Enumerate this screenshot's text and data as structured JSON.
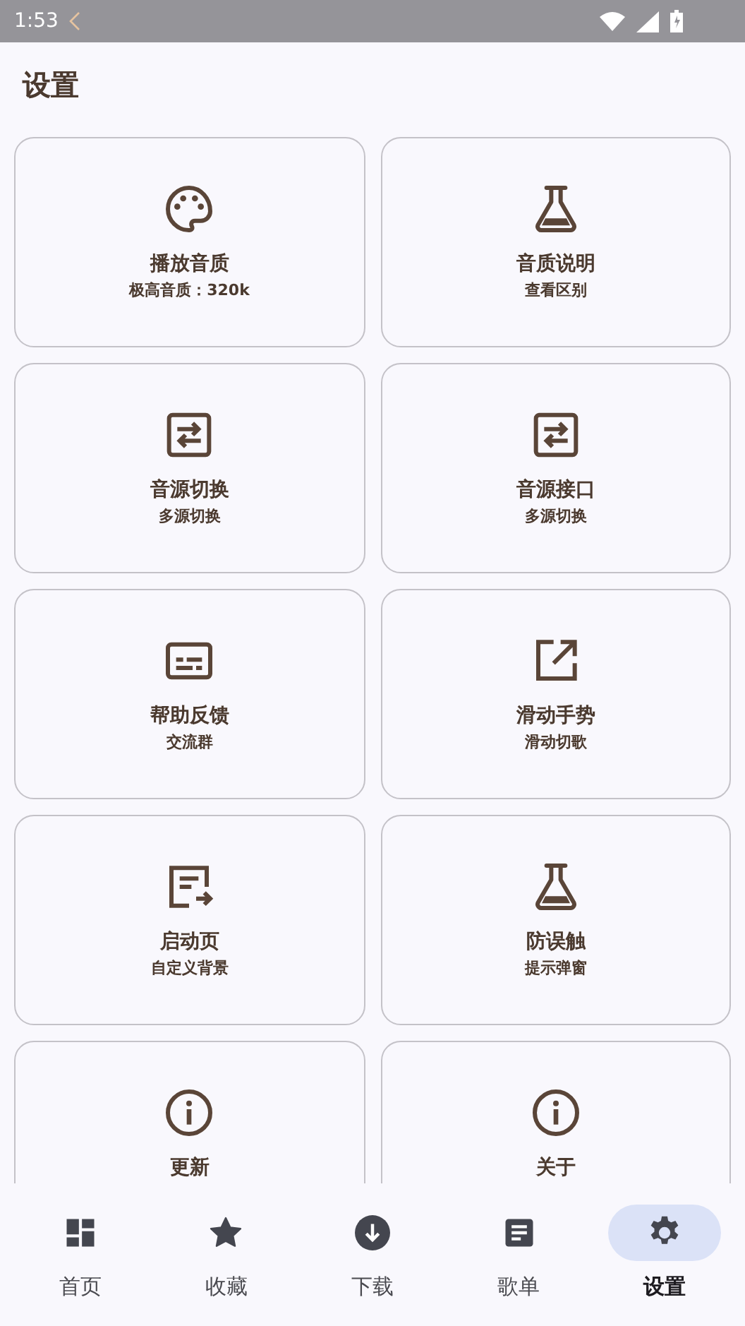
{
  "status_bar": {
    "time": "1:53"
  },
  "header": {
    "title": "设置"
  },
  "cards": [
    {
      "title": "播放音质",
      "subtitle": "极高音质：320k"
    },
    {
      "title": "音质说明",
      "subtitle": "查看区别"
    },
    {
      "title": "音源切换",
      "subtitle": "多源切换"
    },
    {
      "title": "音源接口",
      "subtitle": "多源切换"
    },
    {
      "title": "帮助反馈",
      "subtitle": "交流群"
    },
    {
      "title": "滑动手势",
      "subtitle": "滑动切歌"
    },
    {
      "title": "启动页",
      "subtitle": "自定义背景"
    },
    {
      "title": "防误触",
      "subtitle": "提示弹窗"
    },
    {
      "title": "更新"
    },
    {
      "title": "关于"
    }
  ],
  "nav": [
    {
      "label": "首页",
      "selected": false
    },
    {
      "label": "收藏",
      "selected": false
    },
    {
      "label": "下载",
      "selected": false
    },
    {
      "label": "歌单",
      "selected": false
    },
    {
      "label": "设置",
      "selected": true
    }
  ]
}
